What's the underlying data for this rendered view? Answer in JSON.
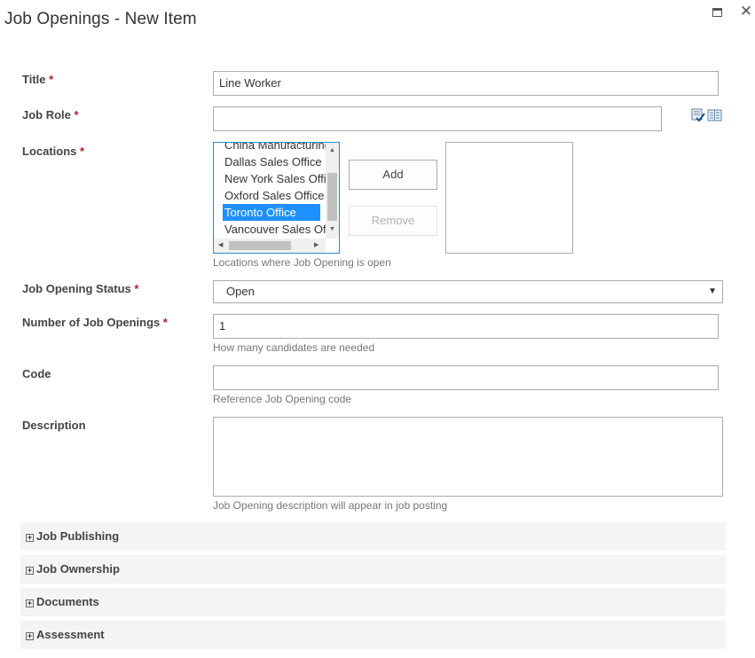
{
  "dialog": {
    "title": "Job Openings - New Item"
  },
  "window_buttons": [
    "maximize-icon",
    "close-icon"
  ],
  "required_marker": "*",
  "fields": {
    "title": {
      "label": "Title",
      "value": "Line Worker"
    },
    "job_role": {
      "label": "Job Role",
      "value": "",
      "icons": [
        "check-names-icon",
        "browse-directory-icon"
      ]
    },
    "locations": {
      "label": "Locations",
      "options": [
        "China Manufacturing",
        "Dallas Sales Office",
        "New York Sales Office",
        "Oxford Sales Office",
        "Toronto Office",
        "Vancouver Sales Office"
      ],
      "selected": "Toronto Office",
      "add_label": "Add",
      "remove_label": "Remove",
      "hint": "Locations where Job Opening is open"
    },
    "status": {
      "label": "Job Opening Status",
      "value": "Open"
    },
    "num_openings": {
      "label": "Number of Job Openings",
      "value": "1",
      "hint": "How many candidates are needed"
    },
    "code": {
      "label": "Code",
      "value": "",
      "hint": "Reference Job Opening code"
    },
    "description": {
      "label": "Description",
      "value": "",
      "hint": "Job Opening description will appear in job posting"
    }
  },
  "sections": [
    {
      "label": "Job Publishing",
      "icon": "expand-plus-icon"
    },
    {
      "label": "Job Ownership",
      "icon": "expand-plus-icon"
    },
    {
      "label": "Documents",
      "icon": "expand-plus-icon"
    },
    {
      "label": "Assessment",
      "icon": "expand-plus-icon"
    }
  ],
  "colors": {
    "required": "#a4262c",
    "selection": "#1e90ff",
    "focus_border": "#2a8dd4",
    "section_bg": "#f4f4f4"
  }
}
